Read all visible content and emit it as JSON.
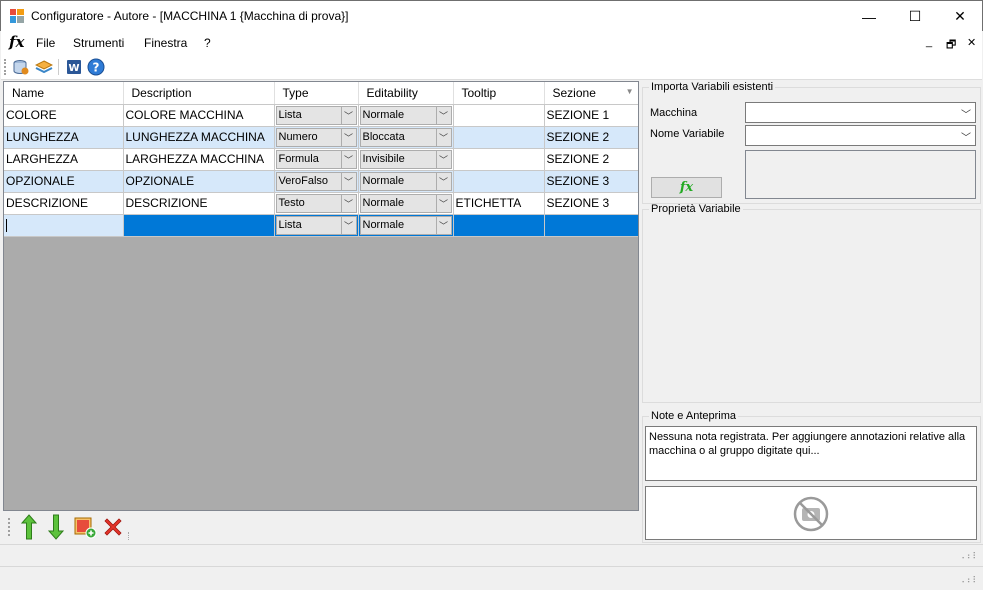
{
  "window": {
    "title": "Configuratore - Autore - [MACCHINA 1 {Macchina di prova}]",
    "minimize": "—",
    "maximize": "☐",
    "close": "✕"
  },
  "menu": {
    "fx": "fx",
    "items": [
      "File",
      "Strumenti",
      "Finestra",
      "?"
    ],
    "mdi_minimize": "_",
    "mdi_restore": "🗗",
    "mdi_close": "✕"
  },
  "grid": {
    "columns": [
      "Name",
      "Description",
      "Type",
      "Editability",
      "Tooltip",
      "Sezione"
    ],
    "rows": [
      {
        "name": "COLORE",
        "description": "COLORE MACCHINA",
        "type": "Lista",
        "editability": "Normale",
        "tooltip": "",
        "sezione": "SEZIONE 1"
      },
      {
        "name": "LUNGHEZZA",
        "description": "LUNGHEZZA MACCHINA",
        "type": "Numero",
        "editability": "Bloccata",
        "tooltip": "",
        "sezione": "SEZIONE 2"
      },
      {
        "name": "LARGHEZZA",
        "description": "LARGHEZZA MACCHINA",
        "type": "Formula",
        "editability": "Invisibile",
        "tooltip": "",
        "sezione": "SEZIONE 2"
      },
      {
        "name": "OPZIONALE",
        "description": "OPZIONALE",
        "type": "VeroFalso",
        "editability": "Normale",
        "tooltip": "",
        "sezione": "SEZIONE 3"
      },
      {
        "name": "DESCRIZIONE",
        "description": "DESCRIZIONE",
        "type": "Testo",
        "editability": "Normale",
        "tooltip": "ETICHETTA",
        "sezione": "SEZIONE 3"
      },
      {
        "name": "",
        "description": "",
        "type": "Lista",
        "editability": "Normale",
        "tooltip": "",
        "sezione": ""
      }
    ]
  },
  "import_panel": {
    "legend": "Importa Variabili esistenti",
    "macchina_label": "Macchina",
    "macchina_value": "",
    "nome_label": "Nome Variabile",
    "nome_value": "",
    "fx_button": "fx"
  },
  "props_panel": {
    "legend": "Proprietà Variabile"
  },
  "notes_panel": {
    "legend": "Note e Anteprima",
    "text": "Nessuna nota registrata. Per aggiungere annotazioni relative alla macchina o al gruppo digitate qui..."
  },
  "colors": {
    "selection": "#0078d7",
    "alt_row": "#d6e8fa",
    "grid_bg": "#ababab"
  }
}
